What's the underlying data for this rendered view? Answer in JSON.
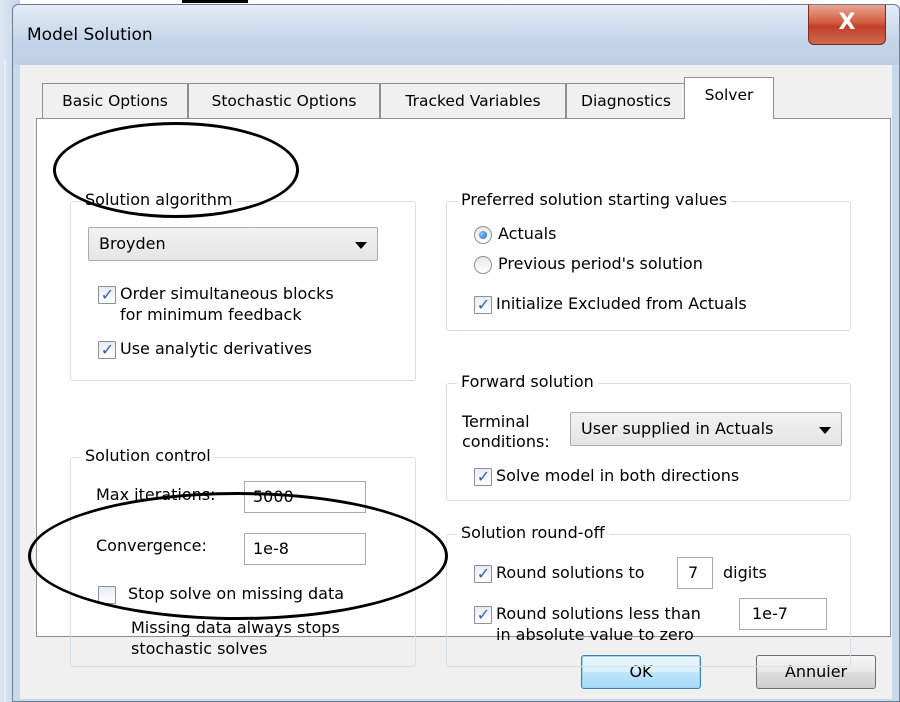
{
  "window": {
    "title": "Model Solution",
    "close_glyph": "X"
  },
  "tabs": [
    {
      "label": "Basic Options",
      "active": false
    },
    {
      "label": "Stochastic Options",
      "active": false
    },
    {
      "label": "Tracked Variables",
      "active": false
    },
    {
      "label": "Diagnostics",
      "active": false
    },
    {
      "label": "Solver",
      "active": true
    }
  ],
  "solution_algorithm": {
    "legend": "Solution algorithm",
    "selected": "Broyden",
    "order_blocks": {
      "label_line1": "Order simultaneous blocks",
      "label_line2": "for  minimum feedback",
      "checked": true
    },
    "analytic_derivatives": {
      "label": "Use analytic derivatives",
      "checked": true
    }
  },
  "starting_values": {
    "legend": "Preferred solution starting values",
    "options": [
      {
        "label": "Actuals",
        "selected": true
      },
      {
        "label": "Previous period's solution",
        "selected": false
      }
    ],
    "initialize_excluded": {
      "label": "Initialize Excluded from Actuals",
      "checked": true
    }
  },
  "forward_solution": {
    "legend": "Forward solution",
    "terminal_label_line1": "Terminal",
    "terminal_label_line2": "conditions:",
    "terminal_selected": "User supplied in Actuals",
    "both_directions": {
      "label": "Solve model in both directions",
      "checked": true
    }
  },
  "solution_control": {
    "legend": "Solution control",
    "max_iterations_label": "Max iterations:",
    "max_iterations_value": "5000",
    "convergence_label": "Convergence:",
    "convergence_value": "1e-8",
    "stop_on_missing": {
      "label": "Stop solve on missing data",
      "checked": false
    },
    "note_line1": "Missing data always stops",
    "note_line2": "stochastic solves"
  },
  "round_off": {
    "legend": "Solution round-off",
    "round_to": {
      "label_before": "Round solutions to",
      "digits_value": "7",
      "label_after": "digits",
      "checked": true
    },
    "round_less": {
      "label_line1": "Round solutions less than",
      "label_line2": "in absolute value to zero",
      "value": "1e-7",
      "checked": true
    }
  },
  "buttons": {
    "ok": "OK",
    "cancel": "Annuler"
  },
  "colors": {
    "close_button": "#c0402a",
    "ok_border": "#3c7fb1",
    "check_mark": "#3a5f9e"
  },
  "icons": {
    "checkbox_checked": "check-icon",
    "dropdown": "chevron-down-icon",
    "close": "close-icon"
  }
}
